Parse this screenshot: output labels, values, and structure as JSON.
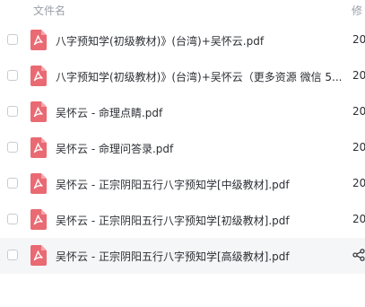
{
  "header": {
    "name_label": "文件名",
    "modified_label": "修"
  },
  "files": [
    {
      "name": "八字预知学(初级教材)》(台湾)+吴怀云.pdf",
      "date": "20"
    },
    {
      "name": "八字预知学(初级教材)》(台湾)+吴怀云（更多资源 微信 5...",
      "date": "20"
    },
    {
      "name": "吴怀云 - 命理点睛.pdf",
      "date": "20"
    },
    {
      "name": "吴怀云 - 命理问答录.pdf",
      "date": "20"
    },
    {
      "name": "吴怀云 - 正宗阴阳五行八字预知学[中级教材].pdf",
      "date": "20"
    },
    {
      "name": "吴怀云 - 正宗阴阳五行八字预知学[初级教材].pdf",
      "date": "20"
    },
    {
      "name": "吴怀云 - 正宗阴阳五行八字预知学[高级教材].pdf",
      "date": ""
    }
  ],
  "icons": {
    "file": "pdf-file-icon",
    "share": "share-icon"
  },
  "colors": {
    "pdf_icon": "#e96a73",
    "hover_row": "#f5f6f8"
  }
}
